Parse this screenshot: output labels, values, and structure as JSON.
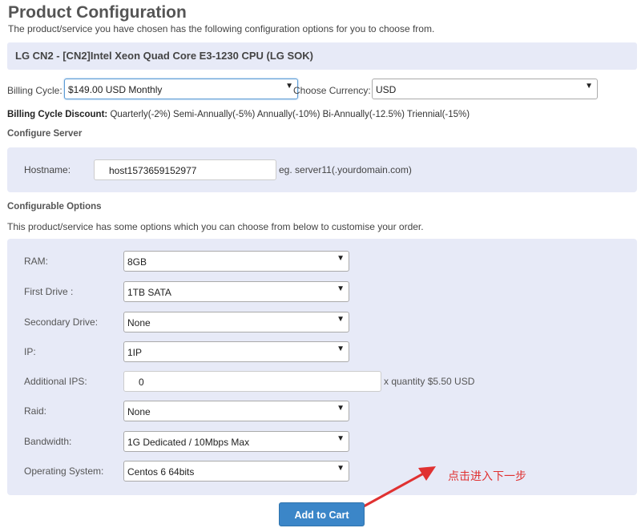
{
  "page": {
    "title": "Product Configuration",
    "subtitle": "The product/service you have chosen has the following configuration options for you to choose from."
  },
  "product": {
    "name": "LG CN2 - [CN2]Intel Xeon Quad Core E3-1230 CPU (LG SOK)"
  },
  "billing": {
    "cycle_label": "Billing Cycle:",
    "cycle_value": "$149.00 USD Monthly",
    "currency_label": "Choose Currency:",
    "currency_value": "USD",
    "discount_label": "Billing Cycle Discount:",
    "discount_text": " Quarterly(-2%) Semi-Annually(-5%) Annually(-10%) Bi-Annually(-12.5%) Triennial(-15%)"
  },
  "configure_server": {
    "heading": "Configure Server",
    "hostname_label": "Hostname:",
    "hostname_value": "host1573659152977",
    "hostname_hint": "eg. server11(.yourdomain.com)"
  },
  "configurable_options": {
    "heading": "Configurable Options",
    "description": "This product/service has some options which you can choose from below to customise your order.",
    "ram": {
      "label": "RAM:",
      "value": "8GB"
    },
    "first_drive": {
      "label": "First Drive :",
      "value": "1TB SATA"
    },
    "secondary_drive": {
      "label": "Secondary Drive:",
      "value": "None"
    },
    "ip": {
      "label": "IP:",
      "value": "1IP"
    },
    "additional_ips": {
      "label": "Additional IPS:",
      "value": "0",
      "hint": "x quantity $5.50 USD"
    },
    "raid": {
      "label": "Raid:",
      "value": "None"
    },
    "bandwidth": {
      "label": "Bandwidth:",
      "value": "1G Dedicated / 10Mbps Max"
    },
    "os": {
      "label": "Operating System:",
      "value": "Centos 6 64bits"
    }
  },
  "actions": {
    "add_to_cart": "Add to Cart"
  },
  "annotation": {
    "text": "点击进入下一步",
    "color": "#e03131"
  },
  "icons": {
    "dropdown": "chevron-down-icon",
    "annotation_arrow": "arrow-icon"
  },
  "colors": {
    "panel_bg": "#e7eaf7",
    "button_bg": "#3b86c8"
  }
}
